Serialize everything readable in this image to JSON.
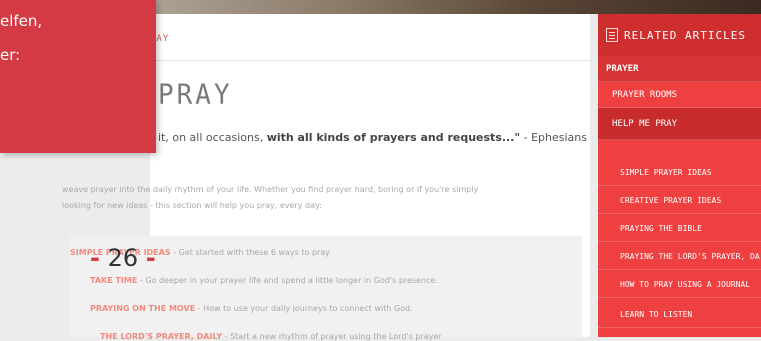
{
  "overlay": {
    "lines": [
      "elfen,",
      "er:"
    ],
    "page_number": "26",
    "page_dash_left": "-",
    "page_dash_right": "-"
  },
  "breadcrumb": "RAY",
  "page_title": "PRAY",
  "quote": {
    "prefix": "it, on all occasions, ",
    "bold": "with all kinds of prayers and requests...\"",
    "suffix": " - Ephesians"
  },
  "intro": {
    "line1": "weave prayer into the daily rhythm of your life. Whether you find prayer hard, boring or if you're simply",
    "line2": "looking for new ideas -  this section will help you pray, every day:"
  },
  "list": [
    {
      "title": "SIMPLE PRAYER IDEAS",
      "desc": "Get started with these 6 ways to pray"
    },
    {
      "title": "TAKE TIME",
      "desc": "Go deeper in your prayer life and spend a little longer in God's presence."
    },
    {
      "title": "PRAYING ON THE MOVE",
      "desc": "How to use your daily journeys to connect with God."
    },
    {
      "title": "THE LORD'S PRAYER, DAILY",
      "desc": "Start a new rhythm of prayer using the Lord's prayer"
    }
  ],
  "sidebar": {
    "title": "RELATED ARTICLES",
    "icon": "document-icon",
    "items": [
      {
        "label": "PRAYER",
        "level": 0
      },
      {
        "label": "PRAYER ROOMS",
        "level": 1
      },
      {
        "label": "HELP ME PRAY",
        "level": 1,
        "active": true
      },
      {
        "label": "SIMPLE PRAYER IDEAS",
        "level": 2
      },
      {
        "label": "CREATIVE PRAYER IDEAS",
        "level": 2
      },
      {
        "label": "PRAYING THE BIBLE",
        "level": 2
      },
      {
        "label": "PRAYING THE LORD'S PRAYER, DA",
        "level": 2
      },
      {
        "label": "HOW TO PRAY USING A JOURNAL",
        "level": 2
      },
      {
        "label": "LEARN TO LISTEN",
        "level": 2
      }
    ]
  },
  "colors": {
    "accent": "#ee4040",
    "overlay": "#d33a44",
    "link": "#f08b80"
  }
}
